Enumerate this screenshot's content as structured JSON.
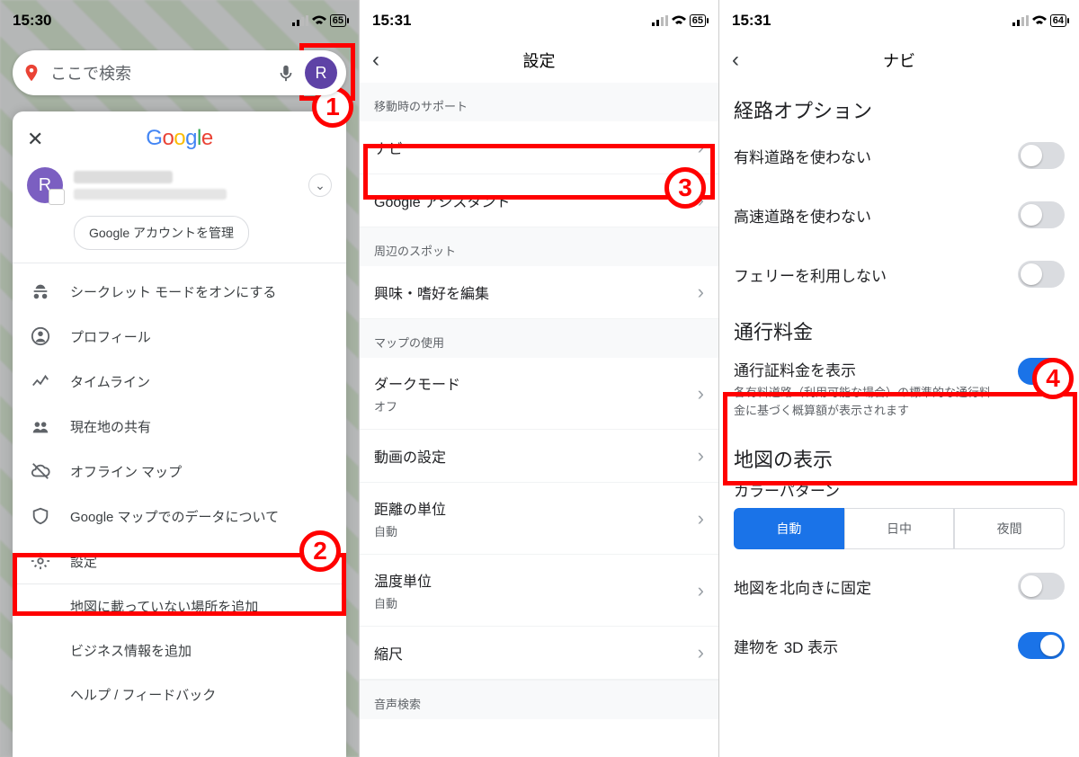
{
  "screen1": {
    "status_time": "15:30",
    "battery": "65",
    "search_placeholder": "ここで検索",
    "avatar_letter": "R",
    "google_logo": "Google",
    "manage_account": "Google アカウントを管理",
    "menu": {
      "incognito": "シークレット モードをオンにする",
      "profile": "プロフィール",
      "timeline": "タイムライン",
      "share_location": "現在地の共有",
      "offline_maps": "オフライン マップ",
      "your_data": "Google マップでのデータについて",
      "settings": "設定",
      "add_missing": "地図に載っていない場所を追加",
      "add_business": "ビジネス情報を追加",
      "help": "ヘルプ / フィードバック"
    }
  },
  "screen2": {
    "status_time": "15:31",
    "battery": "65",
    "title": "設定",
    "sections": {
      "getting_around": "移動時のサポート",
      "navigation": "ナビ",
      "assistant": "Google アシスタント",
      "nearby_spots": "周辺のスポット",
      "edit_interests": "興味・嗜好を編集",
      "using_maps": "マップの使用",
      "dark_mode": "ダークモード",
      "dark_mode_sub": "オフ",
      "video_settings": "動画の設定",
      "distance_units": "距離の単位",
      "distance_units_sub": "自動",
      "temp_units": "温度単位",
      "temp_units_sub": "自動",
      "scale": "縮尺",
      "voice_search": "音声検索"
    }
  },
  "screen3": {
    "status_time": "15:31",
    "battery": "64",
    "title": "ナビ",
    "route_options_label": "経路オプション",
    "avoid_tolls": "有料道路を使わない",
    "avoid_highways": "高速道路を使わない",
    "avoid_ferries": "フェリーを利用しない",
    "toll_label": "通行料金",
    "show_toll_prices": "通行証料金を表示",
    "show_toll_desc": "各有料道路（利用可能な場合）の標準的な通行料金に基づく概算額が表示されます",
    "map_display_label": "地図の表示",
    "color_pattern_label": "カラーパターン",
    "seg_auto": "自動",
    "seg_day": "日中",
    "seg_night": "夜間",
    "north_up": "地図を北向きに固定",
    "buildings_3d": "建物を 3D 表示"
  },
  "badges": {
    "b1": "1",
    "b2": "2",
    "b3": "3",
    "b4": "4"
  }
}
